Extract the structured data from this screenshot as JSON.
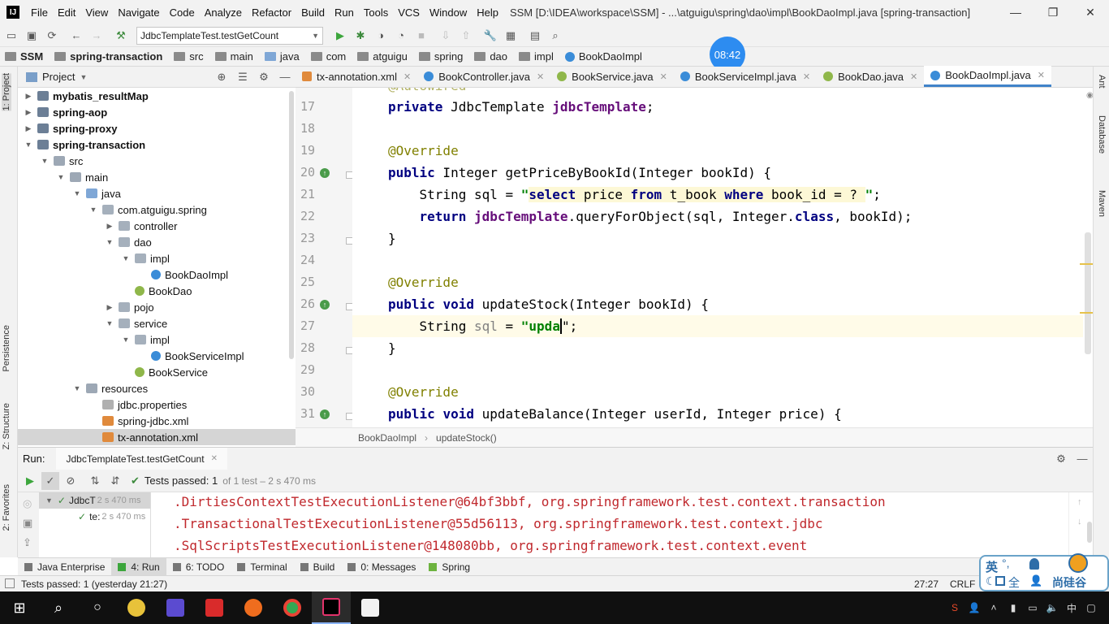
{
  "titlebar": {
    "menu": [
      "File",
      "Edit",
      "View",
      "Navigate",
      "Code",
      "Analyze",
      "Refactor",
      "Build",
      "Run",
      "Tools",
      "VCS",
      "Window",
      "Help"
    ],
    "window_title": "SSM [D:\\IDEA\\workspace\\SSM] - ...\\atguigu\\spring\\dao\\impl\\BookDaoImpl.java [spring-transaction]",
    "minimize": "—",
    "maximize": "❐",
    "close": "✕"
  },
  "toolbar": {
    "run_config": "JdbcTemplateTest.testGetCount"
  },
  "breadcrumb": [
    "SSM",
    "spring-transaction",
    "src",
    "main",
    "java",
    "com",
    "atguigu",
    "spring",
    "dao",
    "impl",
    "BookDaoImpl"
  ],
  "timer_badge": "08:42",
  "left_strip": {
    "project": "1: Project",
    "persistence": "Persistence",
    "structure": "Z: Structure",
    "favorites": "2: Favorites"
  },
  "right_strip": {
    "ant": "Ant",
    "database": "Database",
    "maven": "Maven"
  },
  "project_panel": {
    "title": "Project",
    "tree": [
      {
        "label": "mybatis_resultMap",
        "kind": "module",
        "depth": 1,
        "arrow": "right",
        "bold": true
      },
      {
        "label": "spring-aop",
        "kind": "module",
        "depth": 1,
        "arrow": "right",
        "bold": true
      },
      {
        "label": "spring-proxy",
        "kind": "module",
        "depth": 1,
        "arrow": "right",
        "bold": true
      },
      {
        "label": "spring-transaction",
        "kind": "module",
        "depth": 1,
        "arrow": "down",
        "bold": true
      },
      {
        "label": "src",
        "kind": "folder",
        "depth": 2,
        "arrow": "down",
        "bold": false
      },
      {
        "label": "main",
        "kind": "folder",
        "depth": 3,
        "arrow": "down",
        "bold": false
      },
      {
        "label": "java",
        "kind": "srcfolder",
        "depth": 4,
        "arrow": "down",
        "bold": false
      },
      {
        "label": "com.atguigu.spring",
        "kind": "pkg",
        "depth": 5,
        "arrow": "down",
        "bold": false
      },
      {
        "label": "controller",
        "kind": "pkg",
        "depth": 6,
        "arrow": "right",
        "bold": false
      },
      {
        "label": "dao",
        "kind": "pkg",
        "depth": 6,
        "arrow": "down",
        "bold": false
      },
      {
        "label": "impl",
        "kind": "pkg",
        "depth": 7,
        "arrow": "down",
        "bold": false
      },
      {
        "label": "BookDaoImpl",
        "kind": "cls",
        "depth": 8,
        "arrow": "",
        "bold": false
      },
      {
        "label": "BookDao",
        "kind": "intf",
        "depth": 7,
        "arrow": "",
        "bold": false
      },
      {
        "label": "pojo",
        "kind": "pkg",
        "depth": 6,
        "arrow": "right",
        "bold": false
      },
      {
        "label": "service",
        "kind": "pkg",
        "depth": 6,
        "arrow": "down",
        "bold": false
      },
      {
        "label": "impl",
        "kind": "pkg",
        "depth": 7,
        "arrow": "down",
        "bold": false
      },
      {
        "label": "BookServiceImpl",
        "kind": "cls",
        "depth": 8,
        "arrow": "",
        "bold": false
      },
      {
        "label": "BookService",
        "kind": "intf",
        "depth": 7,
        "arrow": "",
        "bold": false
      },
      {
        "label": "resources",
        "kind": "folder",
        "depth": 4,
        "arrow": "down",
        "bold": false
      },
      {
        "label": "jdbc.properties",
        "kind": "props",
        "depth": 5,
        "arrow": "",
        "bold": false
      },
      {
        "label": "spring-jdbc.xml",
        "kind": "xml",
        "depth": 5,
        "arrow": "",
        "bold": false
      },
      {
        "label": "tx-annotation.xml",
        "kind": "xml",
        "depth": 5,
        "arrow": "",
        "bold": false,
        "selected": true
      }
    ]
  },
  "editor_tabs": [
    {
      "label": "tx-annotation.xml",
      "kind": "xml",
      "active": false
    },
    {
      "label": "BookController.java",
      "kind": "cls",
      "active": false
    },
    {
      "label": "BookService.java",
      "kind": "intf",
      "active": false
    },
    {
      "label": "BookServiceImpl.java",
      "kind": "cls",
      "active": false
    },
    {
      "label": "BookDao.java",
      "kind": "intf",
      "active": false
    },
    {
      "label": "BookDaoImpl.java",
      "kind": "cls",
      "active": true
    }
  ],
  "editor": {
    "line_numbers": [
      "17",
      "18",
      "19",
      "20",
      "21",
      "22",
      "23",
      "24",
      "25",
      "26",
      "27",
      "28",
      "29",
      "30",
      "31"
    ],
    "lines": {
      "l17": {
        "kw": "private",
        "type": " JdbcTemplate ",
        "field": "jdbcTemplate",
        "end": ";"
      },
      "l19": "@Override",
      "l20": {
        "kw": "public",
        "rest": " Integer getPriceByBookId(Integer bookId) {"
      },
      "l21": {
        "pre": "    String sql = ",
        "q1": "\"",
        "s1": "select",
        "s2": " price ",
        "s3": "from",
        "s4": " t_book ",
        "s5": "where",
        "s6": " book_id = ? ",
        "q2": "\"",
        "end": ";"
      },
      "l22": {
        "pre": "    ",
        "kw": "return",
        "sp": " ",
        "field": "jdbcTemplate",
        "mid": ".queryForObject(sql, Integer.",
        "kw2": "class",
        "end": ", bookId);"
      },
      "l23": "}",
      "l25": "@Override",
      "l26": {
        "kw": "public",
        "kw2": "void",
        "rest": " updateStock(Integer bookId) {"
      },
      "l27": {
        "pre": "    String ",
        "var": "sql",
        "eq": " = ",
        "str": "\"upda",
        "after": "\";"
      },
      "l28": "}",
      "l30": "@Override",
      "l31": {
        "kw": "public",
        "kw2": "void",
        "rest": " updateBalance(Integer userId, Integer price) {"
      }
    },
    "breadcrumb": [
      "BookDaoImpl",
      "updateStock()"
    ]
  },
  "run_panel": {
    "label": "Run:",
    "config_tab": "JdbcTemplateTest.testGetCount",
    "status": "Tests passed: 1",
    "status_meta": "of 1 test – 2 s 470 ms",
    "tree": [
      {
        "label": "JdbcT",
        "time": "2 s 470 ms"
      },
      {
        "label": "te:",
        "time": "2 s 470 ms"
      }
    ],
    "console_lines": [
      ".DirtiesContextTestExecutionListener@64bf3bbf, org.springframework.test.context.transaction",
      ".TransactionalTestExecutionListener@55d56113, org.springframework.test.context.jdbc",
      ".SqlScriptsTestExecutionListener@148080bb, org.springframework.test.context.event"
    ]
  },
  "tool_tabs": [
    "Java Enterprise",
    "4: Run",
    "6: TODO",
    "Terminal",
    "Build",
    "0: Messages",
    "Spring"
  ],
  "statusbar": {
    "message": "Tests passed: 1 (yesterday 21:27)",
    "position": "27:27",
    "line_sep": "CRLF"
  },
  "ime": {
    "lang": "英",
    "punct": "°,",
    "full": "全",
    "brand": "尚硅谷"
  },
  "colors": {
    "accent": "#4083c9",
    "console_text": "#c0282d",
    "string_green": "#008000",
    "keyword_navy": "#000080",
    "field_purple": "#660e7a"
  }
}
